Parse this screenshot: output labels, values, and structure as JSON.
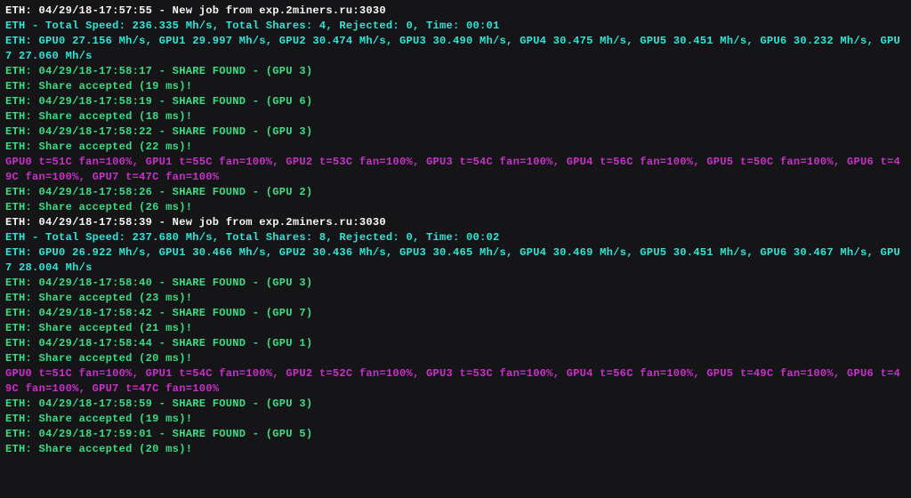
{
  "lines": [
    {
      "color": "white",
      "text": "ETH: 04/29/18-17:57:55 - New job from exp.2miners.ru:3030"
    },
    {
      "color": "cyan",
      "text": "ETH - Total Speed: 236.335 Mh/s, Total Shares: 4, Rejected: 0, Time: 00:01"
    },
    {
      "color": "cyan",
      "text": "ETH: GPU0 27.156 Mh/s, GPU1 29.997 Mh/s, GPU2 30.474 Mh/s, GPU3 30.490 Mh/s, GPU4 30.475 Mh/s, GPU5 30.451 Mh/s, GPU6 30.232 Mh/s, GPU7 27.060 Mh/s"
    },
    {
      "color": "green",
      "text": "ETH: 04/29/18-17:58:17 - SHARE FOUND - (GPU 3)"
    },
    {
      "color": "green",
      "text": "ETH: Share accepted (19 ms)!"
    },
    {
      "color": "green",
      "text": "ETH: 04/29/18-17:58:19 - SHARE FOUND - (GPU 6)"
    },
    {
      "color": "green",
      "text": "ETH: Share accepted (18 ms)!"
    },
    {
      "color": "green",
      "text": "ETH: 04/29/18-17:58:22 - SHARE FOUND - (GPU 3)"
    },
    {
      "color": "green",
      "text": "ETH: Share accepted (22 ms)!"
    },
    {
      "color": "magenta",
      "text": "GPU0 t=51C fan=100%, GPU1 t=55C fan=100%, GPU2 t=53C fan=100%, GPU3 t=54C fan=100%, GPU4 t=56C fan=100%, GPU5 t=50C fan=100%, GPU6 t=49C fan=100%, GPU7 t=47C fan=100%"
    },
    {
      "color": "green",
      "text": "ETH: 04/29/18-17:58:26 - SHARE FOUND - (GPU 2)"
    },
    {
      "color": "green",
      "text": "ETH: Share accepted (26 ms)!"
    },
    {
      "color": "white",
      "text": "ETH: 04/29/18-17:58:39 - New job from exp.2miners.ru:3030"
    },
    {
      "color": "cyan",
      "text": "ETH - Total Speed: 237.680 Mh/s, Total Shares: 8, Rejected: 0, Time: 00:02"
    },
    {
      "color": "cyan",
      "text": "ETH: GPU0 26.922 Mh/s, GPU1 30.466 Mh/s, GPU2 30.436 Mh/s, GPU3 30.465 Mh/s, GPU4 30.469 Mh/s, GPU5 30.451 Mh/s, GPU6 30.467 Mh/s, GPU7 28.004 Mh/s"
    },
    {
      "color": "green",
      "text": "ETH: 04/29/18-17:58:40 - SHARE FOUND - (GPU 3)"
    },
    {
      "color": "green",
      "text": "ETH: Share accepted (23 ms)!"
    },
    {
      "color": "green",
      "text": "ETH: 04/29/18-17:58:42 - SHARE FOUND - (GPU 7)"
    },
    {
      "color": "green",
      "text": "ETH: Share accepted (21 ms)!"
    },
    {
      "color": "green",
      "text": "ETH: 04/29/18-17:58:44 - SHARE FOUND - (GPU 1)"
    },
    {
      "color": "green",
      "text": "ETH: Share accepted (20 ms)!"
    },
    {
      "color": "magenta",
      "text": "GPU0 t=51C fan=100%, GPU1 t=54C fan=100%, GPU2 t=52C fan=100%, GPU3 t=53C fan=100%, GPU4 t=56C fan=100%, GPU5 t=49C fan=100%, GPU6 t=49C fan=100%, GPU7 t=47C fan=100%"
    },
    {
      "color": "green",
      "text": "ETH: 04/29/18-17:58:59 - SHARE FOUND - (GPU 3)"
    },
    {
      "color": "green",
      "text": "ETH: Share accepted (19 ms)!"
    },
    {
      "color": "green",
      "text": "ETH: 04/29/18-17:59:01 - SHARE FOUND - (GPU 5)"
    },
    {
      "color": "green",
      "text": "ETH: Share accepted (20 ms)!"
    }
  ]
}
